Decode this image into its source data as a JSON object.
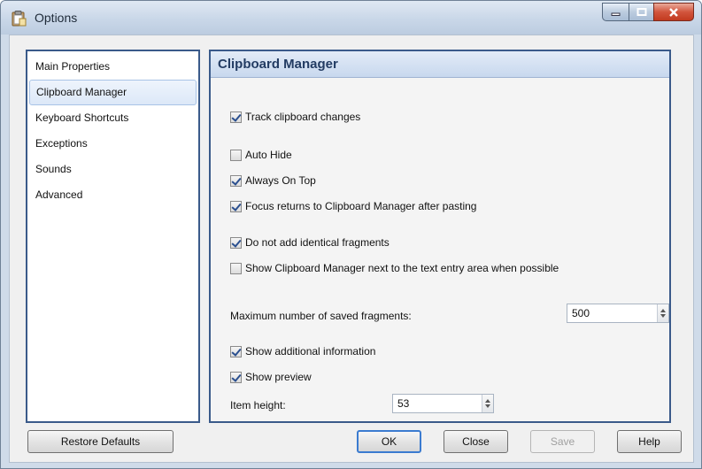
{
  "window": {
    "title": "Options",
    "icon": "clipboard-app-icon"
  },
  "nav": {
    "items": [
      {
        "label": "Main Properties",
        "selected": false
      },
      {
        "label": "Clipboard Manager",
        "selected": true
      },
      {
        "label": "Keyboard Shortcuts",
        "selected": false
      },
      {
        "label": "Exceptions",
        "selected": false
      },
      {
        "label": "Sounds",
        "selected": false
      },
      {
        "label": "Advanced",
        "selected": false
      }
    ]
  },
  "panel": {
    "title": "Clipboard Manager",
    "options": {
      "track_changes": {
        "label": "Track clipboard changes",
        "checked": true
      },
      "auto_hide": {
        "label": "Auto Hide",
        "checked": false
      },
      "always_on_top": {
        "label": "Always On Top",
        "checked": true
      },
      "focus_returns": {
        "label": "Focus returns to Clipboard Manager after pasting",
        "checked": true
      },
      "no_identical": {
        "label": "Do not add identical fragments",
        "checked": true
      },
      "show_next_to_entry": {
        "label": "Show Clipboard Manager next to the text entry area when possible",
        "checked": false
      },
      "show_additional": {
        "label": "Show additional information",
        "checked": true
      },
      "show_preview": {
        "label": "Show preview",
        "checked": true
      }
    },
    "max_fragments": {
      "label": "Maximum number of saved fragments:",
      "value": "500"
    },
    "item_height": {
      "label": "Item height:",
      "value": "53"
    }
  },
  "buttons": {
    "restore_defaults": "Restore Defaults",
    "ok": "OK",
    "close": "Close",
    "save": "Save",
    "help": "Help"
  }
}
